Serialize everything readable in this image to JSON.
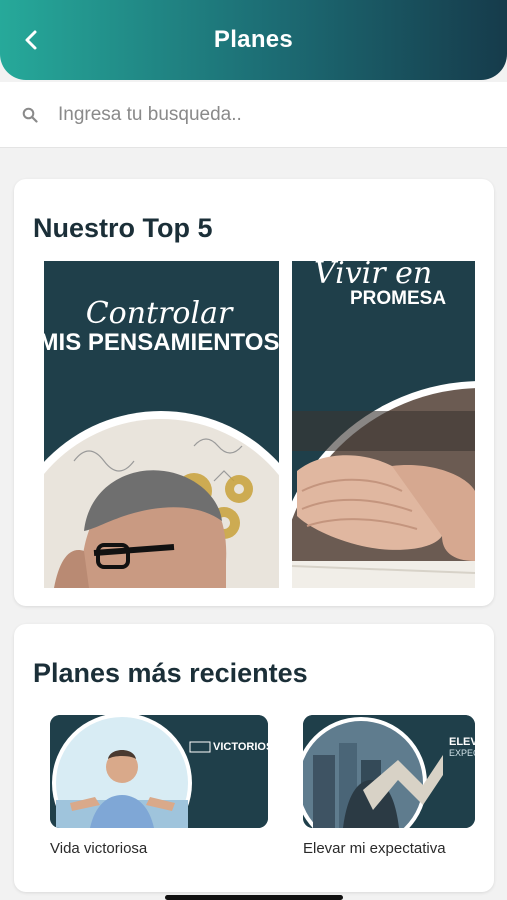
{
  "header": {
    "title": "Planes",
    "back_icon": "chevron-left-icon",
    "gradient": [
      "#26a99a",
      "#163b4b"
    ]
  },
  "search": {
    "placeholder": "Ingresa tu busqueda..",
    "value": "",
    "icon": "search-icon"
  },
  "top5": {
    "title": "Nuestro Top 5",
    "plans": [
      {
        "script_text": "Controlar",
        "headline": "MIS PENSAMIENTOS"
      },
      {
        "script_text": "Vivir en",
        "headline": "PROMESA"
      }
    ]
  },
  "recent": {
    "title": "Planes más recientes",
    "plans": [
      {
        "label": "Vida victoriosa",
        "thumb_text": "VICTORIOSA"
      },
      {
        "label": "Elevar mi expectativa",
        "thumb_text": "ELEV",
        "thumb_subtext": "EXPEC"
      }
    ]
  },
  "colors": {
    "navy": "#1f3f4a",
    "accent": "#26a99a",
    "card": "#ffffff",
    "background": "#f2f2f2"
  }
}
